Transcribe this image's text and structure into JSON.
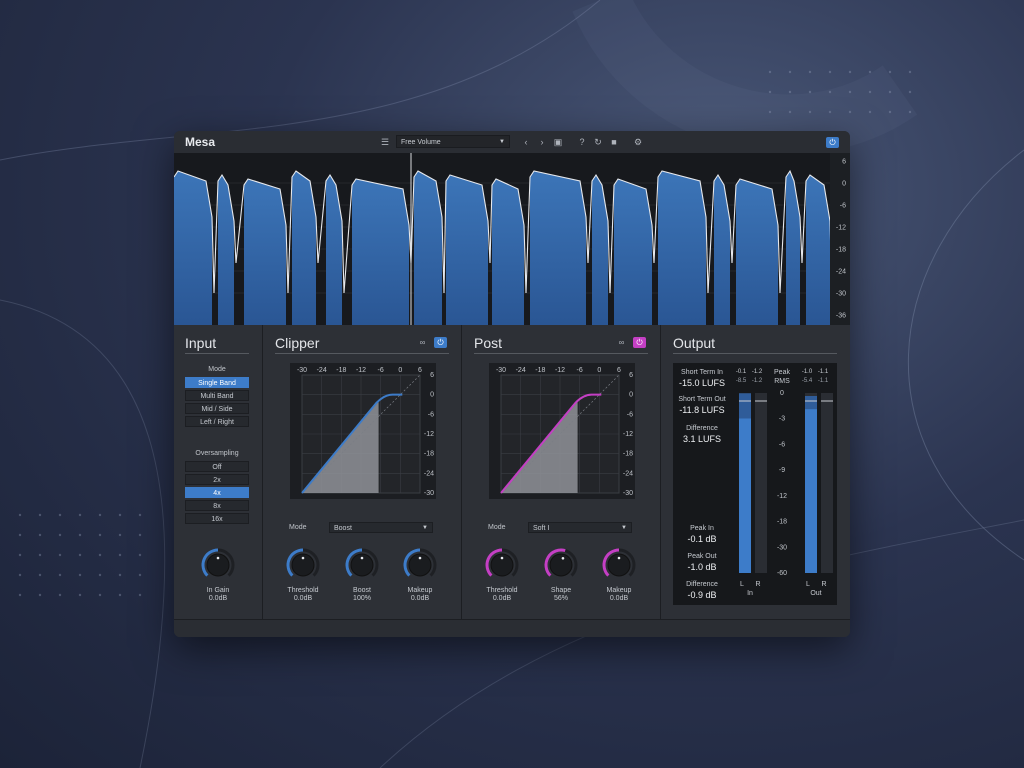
{
  "app": {
    "title": "Mesa",
    "preset": "Free Volume"
  },
  "toolbar": {
    "preset_menu_icon": "list-icon",
    "prev_icon": "chevron-left-icon",
    "next_icon": "chevron-right-icon",
    "save_icon": "save-icon",
    "help_icon": "help-icon",
    "undo_icon": "refresh-icon",
    "lock_icon": "unlock-icon",
    "settings_icon": "gear-icon",
    "power_icon": "power-icon"
  },
  "waveform": {
    "scale": [
      "6",
      "0",
      "-6",
      "-12",
      "-18",
      "-24",
      "-30",
      "-36"
    ]
  },
  "input": {
    "title": "Input",
    "mode_label": "Mode",
    "modes": [
      "Single Band",
      "Multi Band",
      "Mid / Side",
      "Left / Right"
    ],
    "mode_selected": "Single Band",
    "oversampling_label": "Oversampling",
    "oversampling": [
      "Off",
      "2x",
      "4x",
      "8x",
      "16x"
    ],
    "oversampling_selected": "4x",
    "gain_label": "In Gain",
    "gain_value": "0.0dB"
  },
  "clipper": {
    "title": "Clipper",
    "accent": "#3d7cc9",
    "mode_label": "Mode",
    "mode_value": "Boost",
    "top_ticks": [
      "-30",
      "-24",
      "-18",
      "-12",
      "-6",
      "0",
      "6"
    ],
    "side_ticks": [
      "6",
      "0",
      "-6",
      "-12",
      "-18",
      "-24",
      "-30"
    ],
    "knobs": [
      {
        "label": "Threshold",
        "value": "0.0dB",
        "level": 0.5
      },
      {
        "label": "Boost",
        "value": "100%",
        "level": 0.5
      },
      {
        "label": "Makeup",
        "value": "0.0dB",
        "level": 0.5
      }
    ]
  },
  "post": {
    "title": "Post",
    "accent": "#c43fc4",
    "mode_label": "Mode",
    "mode_value": "Soft I",
    "top_ticks": [
      "-30",
      "-24",
      "-18",
      "-12",
      "-6",
      "0",
      "6"
    ],
    "side_ticks": [
      "6",
      "0",
      "-6",
      "-12",
      "-18",
      "-24",
      "-30"
    ],
    "knobs": [
      {
        "label": "Threshold",
        "value": "0.0dB",
        "level": 0.5
      },
      {
        "label": "Shape",
        "value": "56%",
        "level": 0.56
      },
      {
        "label": "Makeup",
        "value": "0.0dB",
        "level": 0.5
      }
    ]
  },
  "output": {
    "title": "Output",
    "short_term_in_label": "Short Term In",
    "short_term_in": "-15.0 LUFS",
    "short_term_out_label": "Short Term Out",
    "short_term_out": "-11.8 LUFS",
    "difference_label": "Difference",
    "difference": "3.1 LUFS",
    "peak_in_label": "Peak In",
    "peak_in": "-0.1 dB",
    "peak_out_label": "Peak Out",
    "peak_out": "-1.0 dB",
    "peak_diff_label": "Difference",
    "peak_diff": "-0.9 dB",
    "in_peaks": [
      "-0.1",
      "-1.2"
    ],
    "in_rms": [
      "-8.5",
      "-1.2"
    ],
    "out_peaks": [
      "-1.0",
      "-1.1"
    ],
    "out_rms": [
      "-5.4",
      "-1.1"
    ],
    "scale_header_1": "Peak",
    "scale_header_2": "RMS",
    "scale": [
      "0",
      "-3",
      "-6",
      "-9",
      "-12",
      "-18",
      "-30",
      "-60"
    ],
    "in_label": "In",
    "out_label": "Out",
    "ch_l": "L",
    "ch_r": "R"
  }
}
